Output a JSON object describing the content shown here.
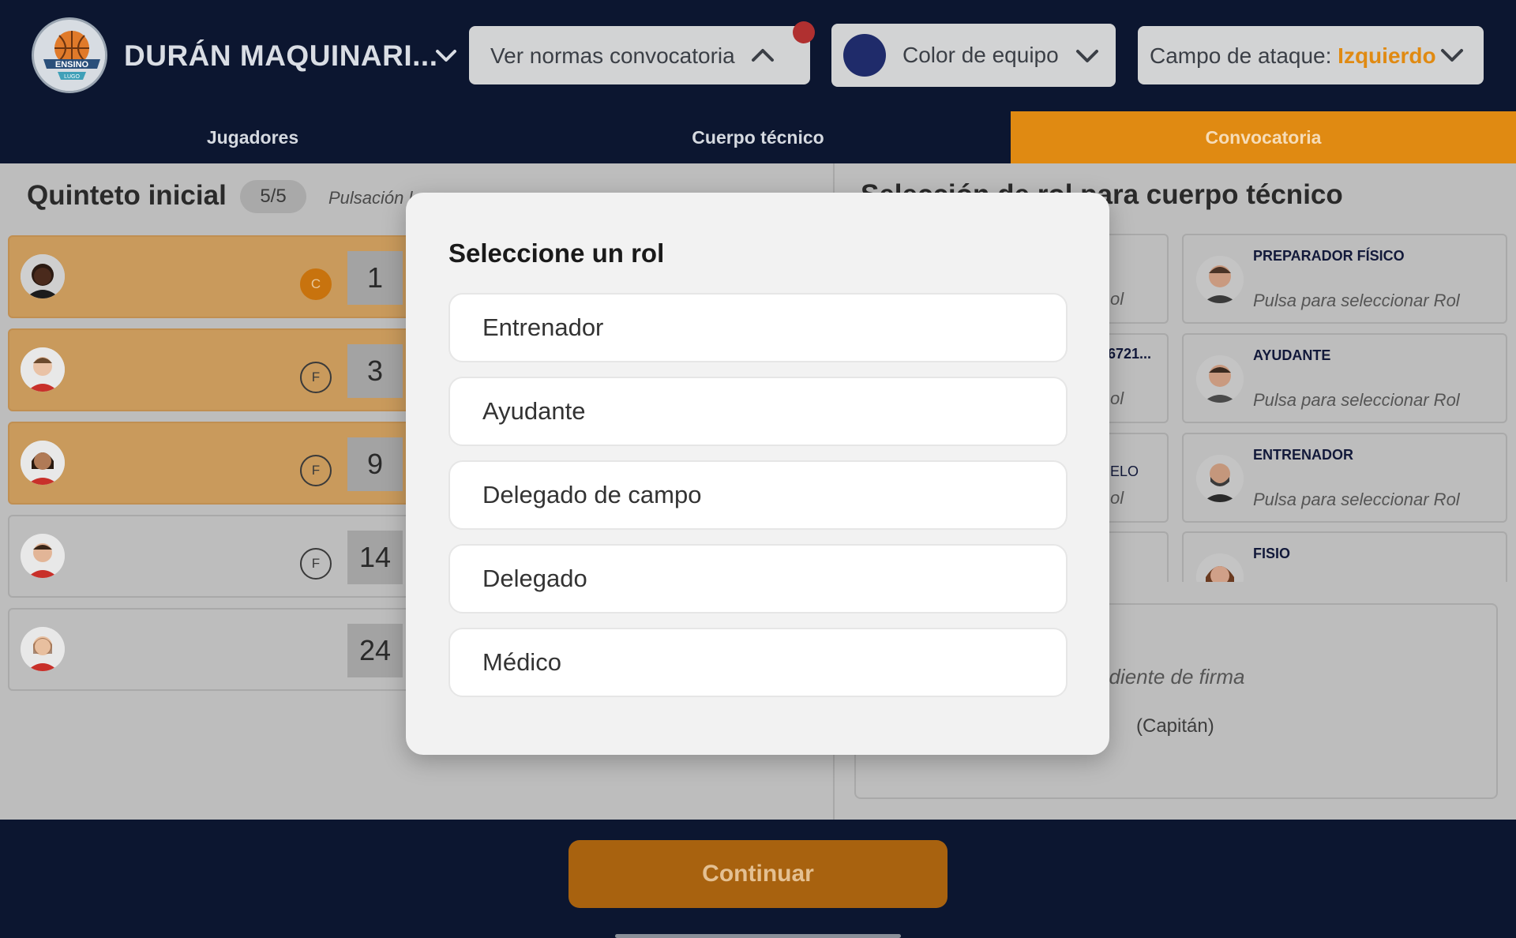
{
  "header": {
    "team_name": "DURÁN MAQUINARI...",
    "logo_text": "ENSINO LUGO",
    "rules_dropdown": {
      "label": "Ver normas convocatoria"
    },
    "color_dropdown": {
      "label": "Color de equipo",
      "swatch_color": "#1f2b6a"
    },
    "attack_dropdown": {
      "label": "Campo de ataque:",
      "value": "Izquierdo"
    }
  },
  "tabs": [
    {
      "label": "Jugadores",
      "active": false
    },
    {
      "label": "Cuerpo técnico",
      "active": false
    },
    {
      "label": "Convocatoria",
      "active": true
    }
  ],
  "lineup": {
    "title": "Quinteto inicial",
    "count": "5/5",
    "hint": "Pulsación l",
    "players": [
      {
        "number": "1",
        "badge": "C",
        "starter": true
      },
      {
        "number": "3",
        "badge": "F",
        "starter": true
      },
      {
        "number": "9",
        "badge": "F",
        "starter": true
      },
      {
        "number": "14",
        "badge": "F",
        "starter": false
      },
      {
        "number": "24",
        "badge": "",
        "starter": false
      }
    ]
  },
  "staff": {
    "title": "Selección de rol para cuerpo técnico",
    "cards": [
      {
        "role": "PREPARADOR FÍSICO",
        "select_hint": "Pulsa para seleccionar Rol"
      },
      {
        "role": "AYUDANTE",
        "select_hint": "Pulsa para seleccionar Rol"
      },
      {
        "role": "ENTRENADOR",
        "select_hint": "Pulsa para seleccionar Rol"
      },
      {
        "role": "FISIO",
        "select_hint": ""
      }
    ],
    "left_fragments": {
      "row1": "ol",
      "row2_id": "6721...",
      "row2": "ol",
      "row3_name": "ELO",
      "row3": "ol"
    }
  },
  "signature": {
    "status": "ndiente de firma",
    "captain": "(Capitán)"
  },
  "footer": {
    "continue_label": "Continuar"
  },
  "modal": {
    "title": "Seleccione un rol",
    "options": [
      "Entrenador",
      "Ayudante",
      "Delegado de campo",
      "Delegado",
      "Médico"
    ]
  },
  "colors": {
    "navy": "#0c1630",
    "accent_orange": "#e08a12",
    "continue_button": "#a8620f",
    "modal_bg": "#f2f2f2"
  }
}
